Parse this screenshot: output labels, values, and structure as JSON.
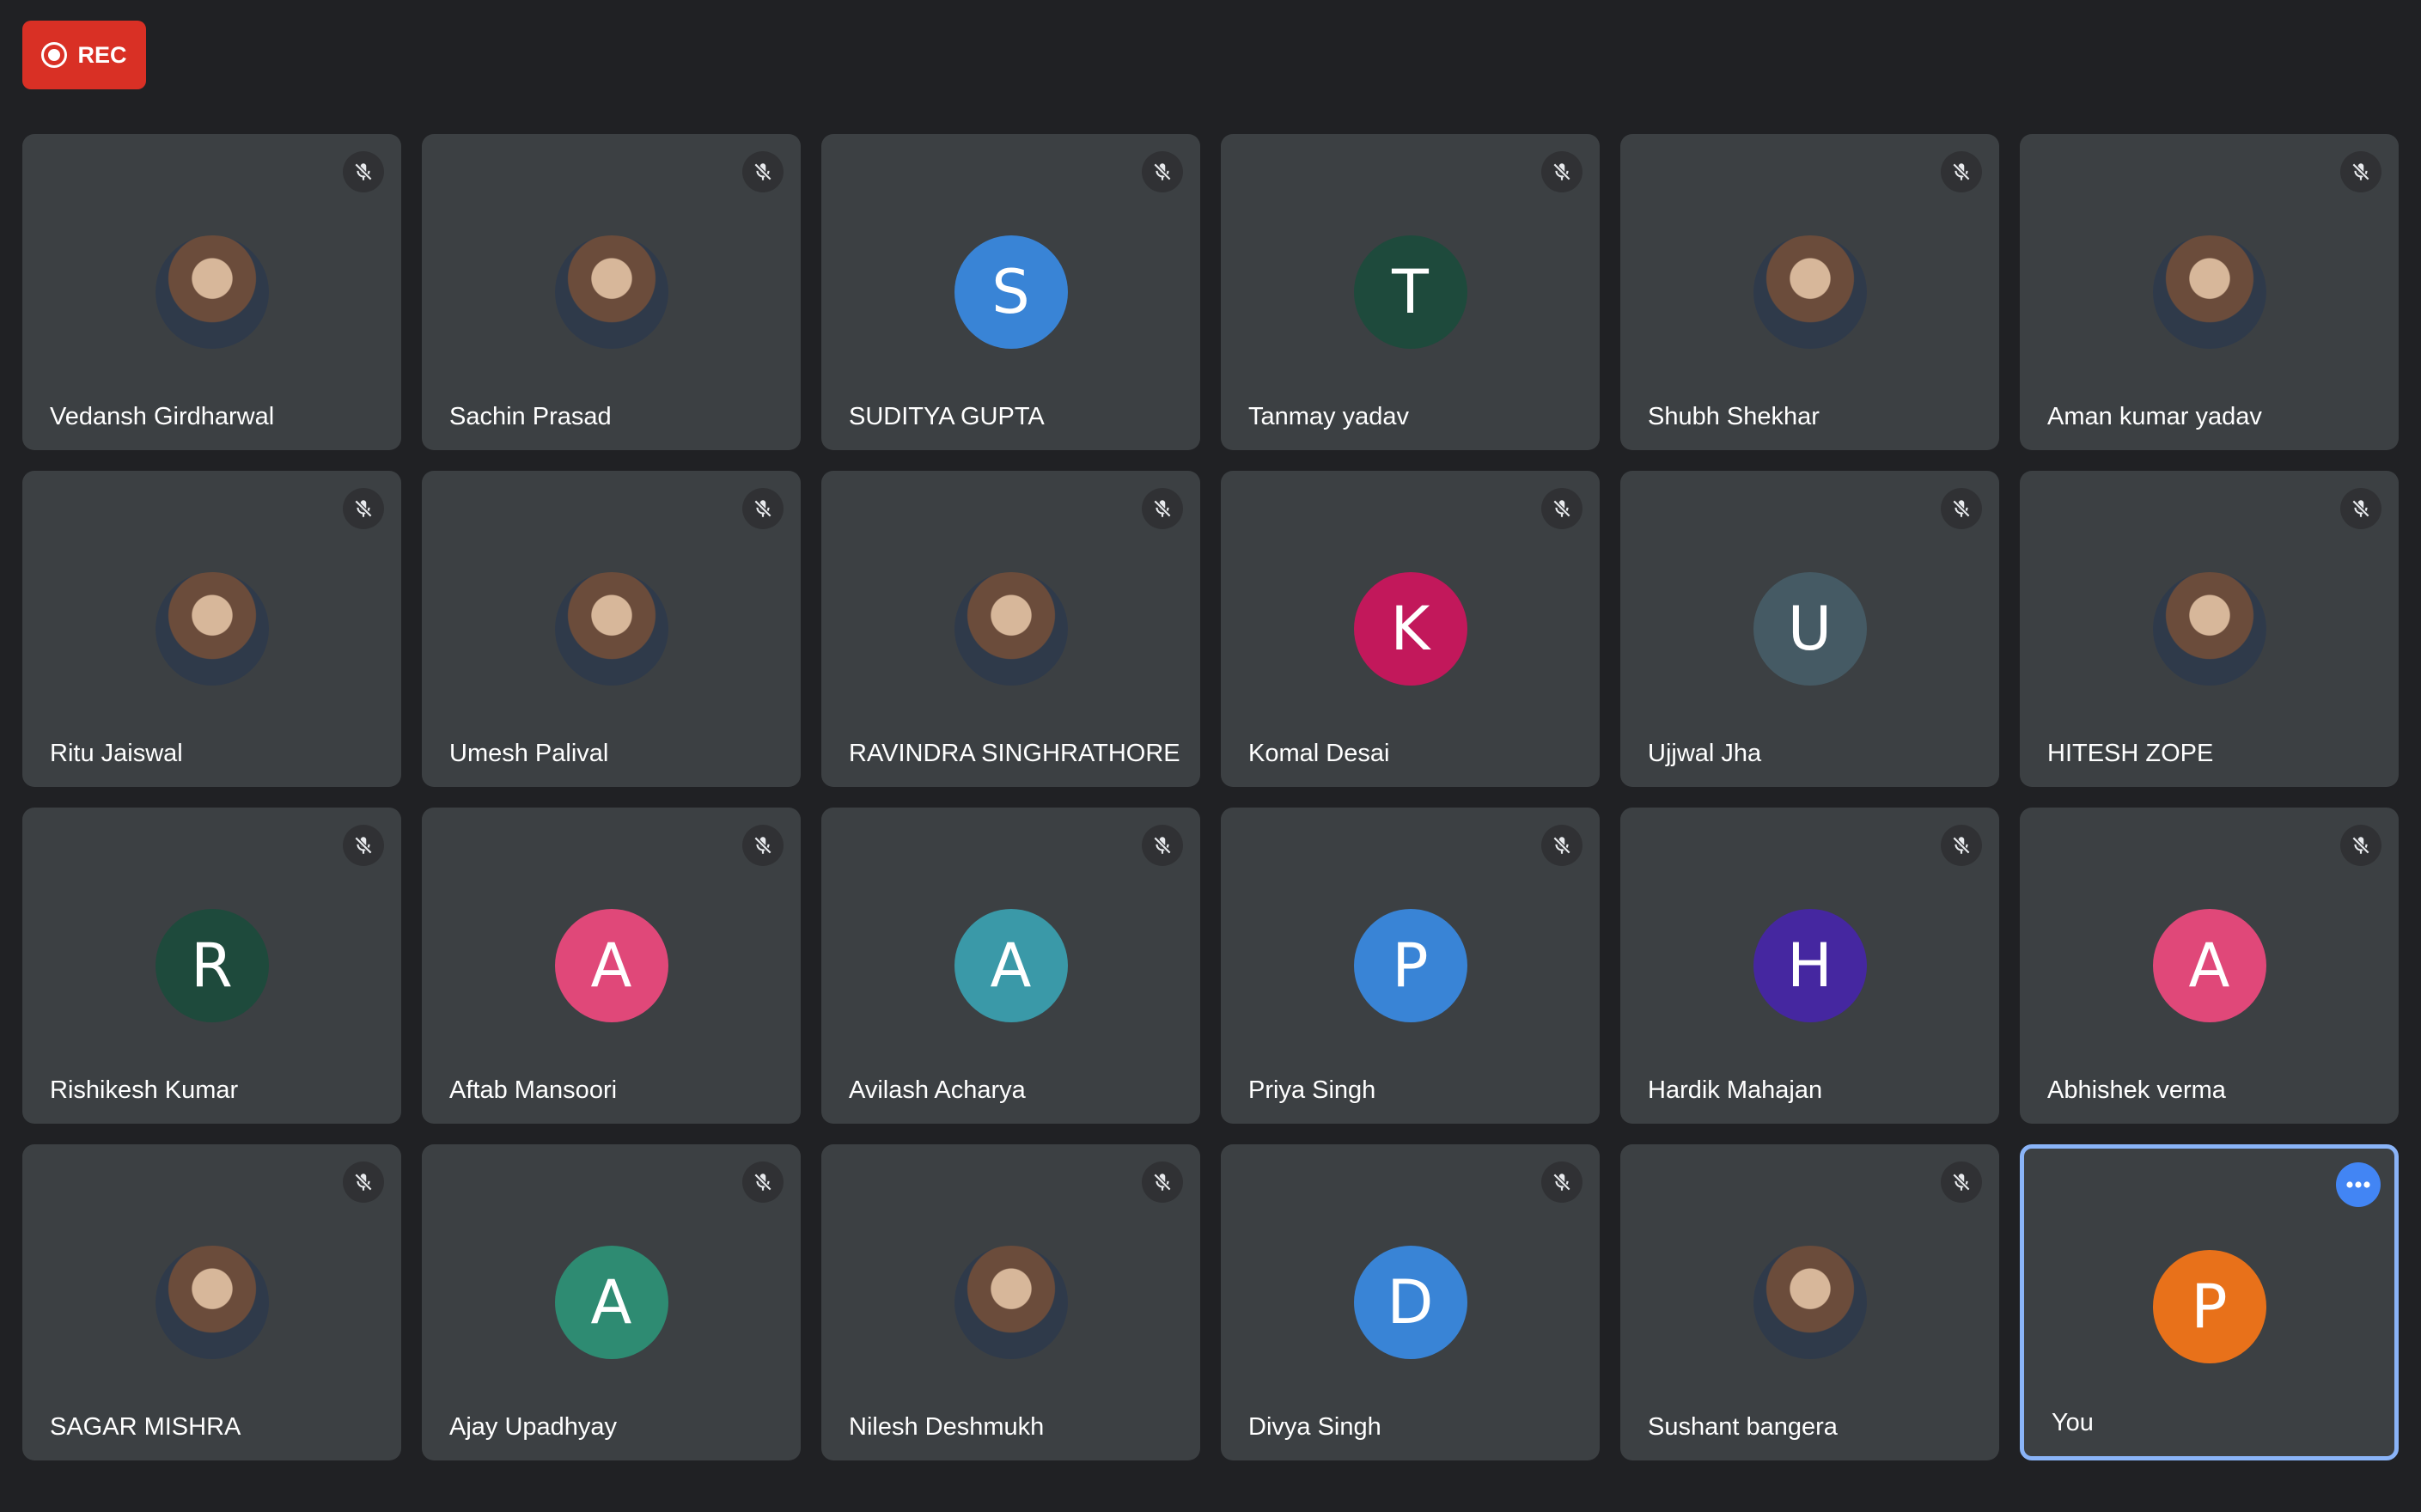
{
  "recording": {
    "label": "REC",
    "color": "#d93025"
  },
  "participants": [
    {
      "name": "Vedansh Girdharwal",
      "avatar_type": "photo",
      "muted": true
    },
    {
      "name": "Sachin Prasad",
      "avatar_type": "photo",
      "muted": true
    },
    {
      "name": "SUDITYA GUPTA",
      "avatar_type": "initial",
      "initial": "S",
      "color": "#3984d6",
      "muted": true
    },
    {
      "name": "Tanmay yadav",
      "avatar_type": "initial",
      "initial": "T",
      "color": "#1e4a3c",
      "muted": true
    },
    {
      "name": "Shubh Shekhar",
      "avatar_type": "photo",
      "muted": true
    },
    {
      "name": "Aman kumar yadav",
      "avatar_type": "photo",
      "muted": true
    },
    {
      "name": "Ritu Jaiswal",
      "avatar_type": "photo",
      "muted": true
    },
    {
      "name": "Umesh Palival",
      "avatar_type": "photo",
      "muted": true
    },
    {
      "name": "RAVINDRA SINGHRATHORE",
      "avatar_type": "photo",
      "muted": true
    },
    {
      "name": "Komal Desai",
      "avatar_type": "initial",
      "initial": "K",
      "color": "#c2185b",
      "muted": true
    },
    {
      "name": "Ujjwal Jha",
      "avatar_type": "initial",
      "initial": "U",
      "color": "#455a64",
      "muted": true
    },
    {
      "name": "HITESH ZOPE",
      "avatar_type": "photo",
      "muted": true
    },
    {
      "name": "Rishikesh Kumar",
      "avatar_type": "initial",
      "initial": "R",
      "color": "#1e4a3c",
      "muted": true
    },
    {
      "name": "Aftab Mansoori",
      "avatar_type": "initial",
      "initial": "A",
      "color": "#e04879",
      "muted": true
    },
    {
      "name": "Avilash Acharya",
      "avatar_type": "initial",
      "initial": "A",
      "color": "#3a99a8",
      "muted": true
    },
    {
      "name": "Priya Singh",
      "avatar_type": "initial",
      "initial": "P",
      "color": "#3984d6",
      "muted": true
    },
    {
      "name": "Hardik Mahajan",
      "avatar_type": "initial",
      "initial": "H",
      "color": "#4527a0",
      "muted": true
    },
    {
      "name": "Abhishek verma",
      "avatar_type": "initial",
      "initial": "A",
      "color": "#e04879",
      "muted": true
    },
    {
      "name": "SAGAR MISHRA",
      "avatar_type": "photo",
      "muted": true
    },
    {
      "name": "Ajay Upadhyay",
      "avatar_type": "initial",
      "initial": "A",
      "color": "#2e8b72",
      "muted": true
    },
    {
      "name": "Nilesh Deshmukh",
      "avatar_type": "photo",
      "muted": true
    },
    {
      "name": "Divya Singh",
      "avatar_type": "initial",
      "initial": "D",
      "color": "#3984d6",
      "muted": true
    },
    {
      "name": "Sushant bangera",
      "avatar_type": "photo",
      "muted": true
    },
    {
      "name": "You",
      "avatar_type": "initial",
      "initial": "P",
      "color": "#e8711a",
      "muted": false,
      "self": true
    }
  ]
}
